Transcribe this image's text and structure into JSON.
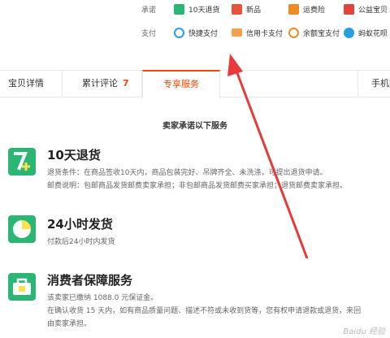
{
  "service_bar": {
    "promise_label": "承诺",
    "promise_items": [
      "10天退货",
      "新品",
      "运费险",
      "公益宝贝"
    ],
    "pay_label": "支付",
    "pay_items": [
      "快捷支付",
      "信用卡支付",
      "余额宝支付",
      "蚂蚁花呗"
    ]
  },
  "tabs": {
    "details": "宝贝详情",
    "reviews": "累计评论",
    "reviews_count": "7",
    "services": "专享服务",
    "mobile": "手机购"
  },
  "section_heading": "卖家承诺以下服务",
  "promises": [
    {
      "title": "10天退货",
      "lines": [
        "退货条件：在商品签收10天内，商品包装完好、吊牌齐全、未洗涤，可提出退货申请。",
        "邮费说明：包邮商品发货邮费卖家承担；非包邮商品发货邮费买家承担；退货邮费卖家承担。"
      ]
    },
    {
      "title": "24小时发货",
      "lines": [
        "付款后24小时内发货"
      ]
    },
    {
      "title": "消费者保障服务",
      "lines": [
        "该卖家已缴纳 1088.0 元保证金。",
        "在确认收货 15 天内，如有商品质量问题、描述不符或未收到货等，您有权申请退款或退货，来回",
        "由卖家承担。"
      ]
    }
  ],
  "watermark": "Baidu 经验",
  "colors": {
    "accent": "#ff4400",
    "green": "#2bb673",
    "arrow": "#e83a3a"
  }
}
